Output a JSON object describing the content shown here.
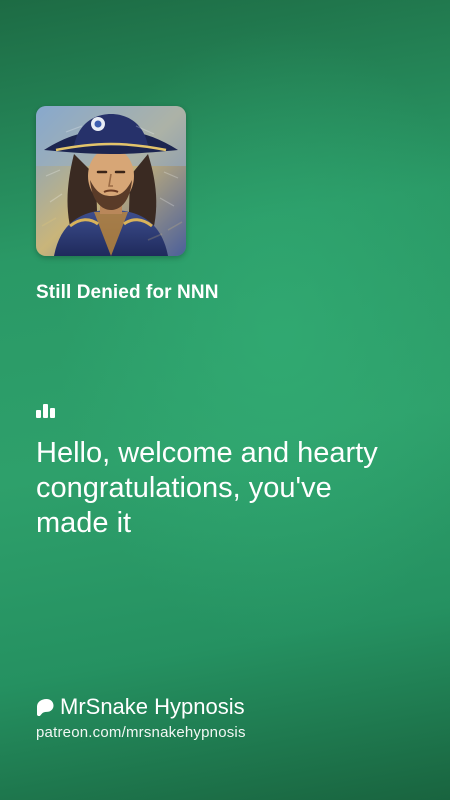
{
  "colors": {
    "background_top": "#1d6b44",
    "background_mid": "#2ea06b",
    "background_bottom": "#19643f",
    "text": "#ffffff"
  },
  "artwork": {
    "icon": "pirate-portrait-artwork"
  },
  "track": {
    "title": "Still Denied for NNN"
  },
  "lyrics": {
    "icon": "bar-chart-icon",
    "text": "Hello, welcome and hearty congratulations, you've made it"
  },
  "creator": {
    "icon": "patreon-icon",
    "name": "MrSnake Hypnosis",
    "url": "patreon.com/mrsnakehypnosis"
  }
}
